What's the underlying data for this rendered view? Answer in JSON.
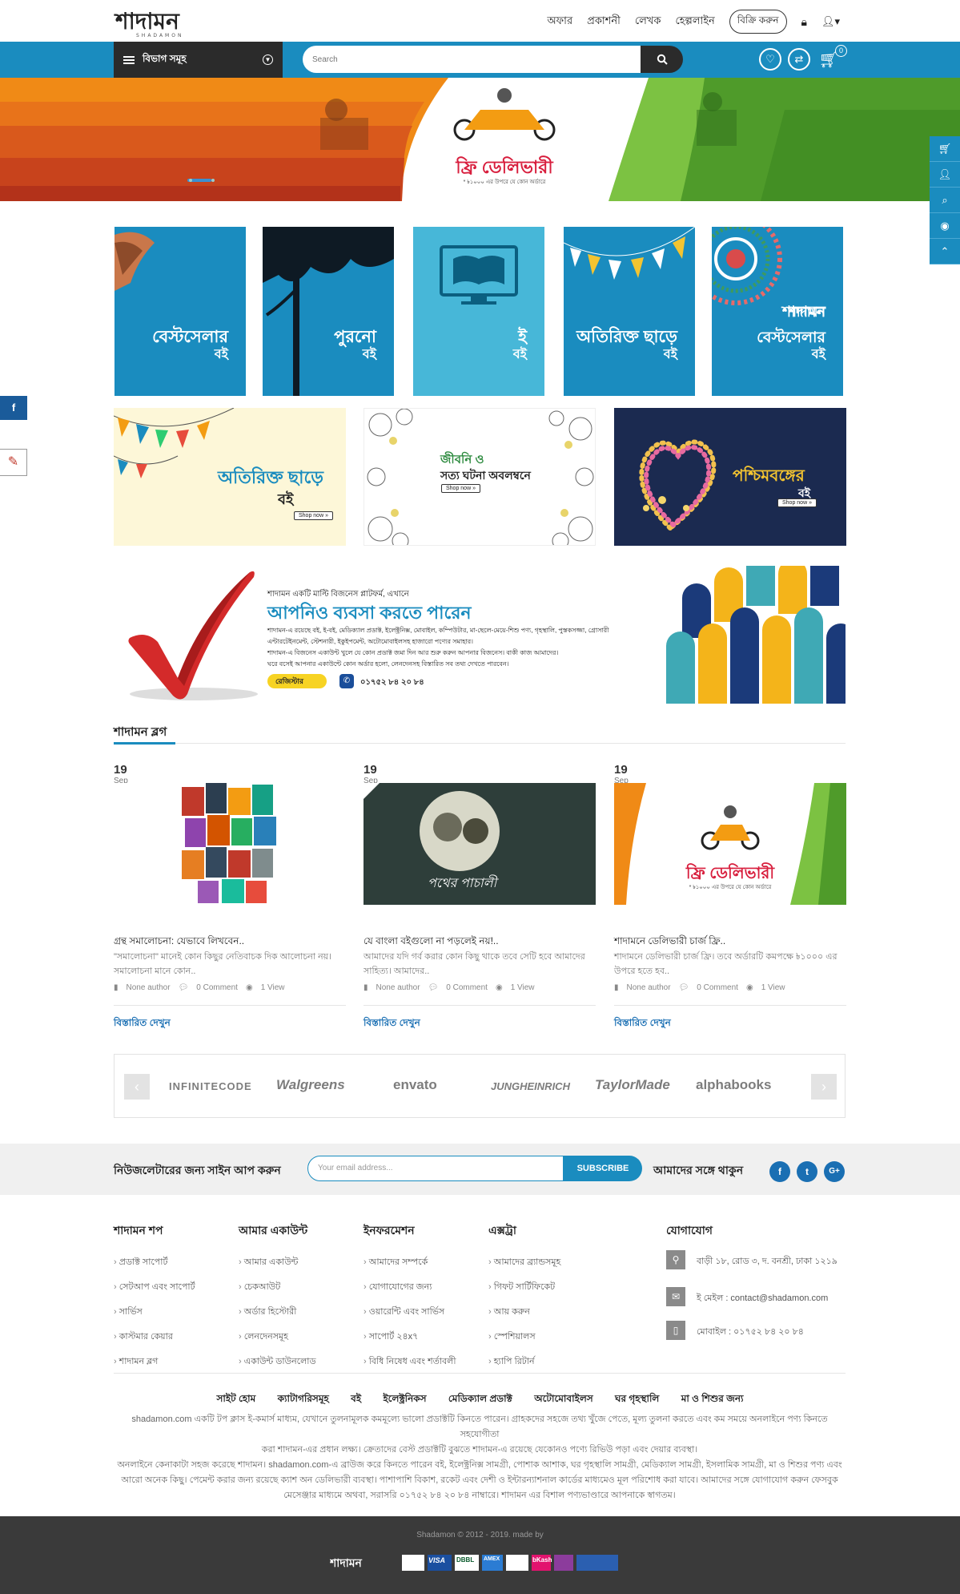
{
  "header": {
    "logo_text": "শাদামন",
    "nav": [
      "অফার",
      "প্রকাশনী",
      "লেখক",
      "হেল্পলাইন"
    ],
    "sell_label": "বিক্রি করুন",
    "departments_label": "বিভাগ সমূহ",
    "search_placeholder": "Search",
    "cart_count": "0"
  },
  "hero": {
    "title": "ফ্রি ডেলিভারী",
    "subtitle": "* ৳১০০০ এর উপরে যে কোন অর্ডারে"
  },
  "tiles": [
    {
      "line1": "বেস্টসেলার",
      "line2": "বই"
    },
    {
      "line1": "পুরনো",
      "line2": "বই"
    },
    {
      "line1": "ই",
      "line2": "বই"
    },
    {
      "line1": "অতিরিক্ত ছাড়ে",
      "line2": "বই"
    },
    {
      "line1": "শাদামন বেস্টসেলার",
      "line2": "বই"
    }
  ],
  "banners": [
    {
      "line1": "অতিরিক্ত ছাড়ে",
      "line2": "বই",
      "cta": "Shop now »"
    },
    {
      "line1": "জীবনি ও",
      "line2": "সত্য ঘটনা অবলম্বনে",
      "cta": "Shop now »"
    },
    {
      "line1": "পশ্চিমবঙ্গের",
      "line2": "বই",
      "cta": "Shop now »"
    }
  ],
  "promo": {
    "intro": "শাদামন একটি মাল্টি বিজনেস প্লাটফর্ম, এখানে",
    "headline": "আপনিও ব্যবসা করতে পারেন",
    "body1": "শাদামন-এ রয়েছে বই, ই-বই, মেডিক্যাল প্রডাক্ট, ইলেক্ট্রনিক্স, মোবাইল, কম্পিউটার, মা-ছেলে-মেয়ে-শিশু পণ্য, গৃহস্থালি, পুস্তকসজ্জা, গ্রোসারী",
    "body2": "এন্টারটেইনমেন্ট, স্টেশনারী, ইকুইপমেন্ট, অটোমোবাইলসহ হাজারো পণ্যের সমাহার।",
    "body3": "শাদামন-এ বিজনেস একাউন্ট খুলে যে কোন প্রডাক্ট জমা দিন আর শুরু করুন আপনার বিজনেস। বাকী কাজ আমাদের।",
    "body4": "ঘরে বসেই আপনার একাউন্টে কোন অর্ডার হলো, লেনদেনসহ বিস্তারিত সব তথ্য দেখতে পারবেন।",
    "register_label": "রেজিস্টার",
    "phone": "০১৭৫২ ৮৪ ২০ ৮৪"
  },
  "blog": {
    "title": "শাদামন ব্লগ",
    "posts": [
      {
        "day": "19",
        "month": "Sep",
        "title": "গ্রন্থ সমালোচনা: যেভাবে লিখবেন..",
        "excerpt": "\"সমালোচনা\" মানেই কোন কিছুর নেতিবাচক দিক আলোচনা নয়। সমালোচনা মানে কোন..",
        "author": "None author",
        "comments": "0 Comment",
        "views": "1 View",
        "more": "বিস্তারিত দেখুন"
      },
      {
        "day": "19",
        "month": "Sep",
        "title": "যে বাংলা বইগুলো না পড়লেই নয়!..",
        "excerpt": "আমাদের যদি গর্ব করার কোন কিছু থাকে তবে সেটি হবে আমাদের সাহিত্য। আমাদের..",
        "author": "None author",
        "comments": "0 Comment",
        "views": "1 View",
        "more": "বিস্তারিত দেখুন",
        "img_caption": "পথের পাচালী"
      },
      {
        "day": "19",
        "month": "Sep",
        "title": "শাদামনে ডেলিভারী চার্জ ফ্রি..",
        "excerpt": "শাদামনে ডেলিভারী চার্জ ফ্রি। তবে অর্ডারটি কমপক্ষে ৳১০০০ এর উপরে হতে হব..",
        "author": "None author",
        "comments": "0 Comment",
        "views": "1 View",
        "more": "বিস্তারিত দেখুন",
        "img_title": "ফ্রি ডেলিভারী",
        "img_sub": "* ৳১০০০ এর উপরে যে কোন অর্ডারে"
      }
    ]
  },
  "brands": [
    "INFINITECODE",
    "Walgreens",
    "envato",
    "JUNGHEINRICH",
    "TaylorMade",
    "alphabooks"
  ],
  "newsletter": {
    "label": "নিউজলেটারের জন্য সাইন আপ করুন",
    "placeholder": "Your email address...",
    "button": "SUBSCRIBE",
    "stay": "আমাদের সঙ্গে থাকুন"
  },
  "footer": {
    "columns": [
      {
        "title": "শাদামন শপ",
        "items": [
          "প্রডাক্ট সাপোর্ট",
          "সেটআপ এবং সাপোর্ট",
          "সার্ভিস",
          "কাস্টমার কেয়ার",
          "শাদামন ব্লগ"
        ]
      },
      {
        "title": "আমার একাউন্ট",
        "items": [
          "আমার একাউন্ট",
          "চেকআউট",
          "অর্ডার হিস্টোরী",
          "লেনদেনসমূহ",
          "একাউন্ট ডাউনলোড"
        ]
      },
      {
        "title": "ইনফরমেশন",
        "items": [
          "আমাদের সম্পর্কে",
          "যোগাযোগের জন্য",
          "ওয়ারেন্টি এবং সার্ভিস",
          "সাপোর্ট ২৪x৭",
          "বিধি নিষেধ এবং শর্তাবলী"
        ]
      },
      {
        "title": "এক্সট্রা",
        "items": [
          "আমাদের ব্র্যান্ডসমূহ",
          "গিফট সার্টিফিকেট",
          "আয় করুন",
          "স্পেশিয়ালস",
          "হ্যাপি রিটার্ন"
        ]
      }
    ],
    "contact_title": "যোগাযোগ",
    "address": "বাড়ী ১৮, রোড ৩, দ. বনশ্রী, ঢাকা ১২১৯",
    "email": "ই মেইল : contact@shadamon.com",
    "phone": "মোবাইল : ০১৭৫২ ৮৪ ২০ ৮৪",
    "links": [
      "সাইট হোম",
      "ক্যাটাগরিসমূহ",
      "বই",
      "ইলেক্ট্রনিকস",
      "মেডিক্যাল প্রডাক্ট",
      "অটোমোবাইলস",
      "ঘর গৃহস্থালি",
      "মা ও শিশুর জন্য"
    ],
    "para1a": "shadamon.com একটি টপ ক্লাস ই-কমার্স মাধ্যম, যেখানে তুলনামূলক কমমূল্যে ভালো প্রডাক্টটি কিনতে পারেন। গ্রাহকদের সহজে তথ্য খুঁজে পেতে, মূল্য তুলনা করতে এবং কম সময়ে অনলাইনে পণ্য কিনতে সহযোগীতা",
    "para1b": "করা শাদামন-এর প্রধান লক্ষ্য। ক্রেতাদের বেস্ট প্রডাক্টটি বুঝতে শাদামন-এ রয়েছে যেকোনও পণ্যে রিভিউ পড়া এবং দেয়ার ব্যবস্থা।",
    "para2a": "অনলাইনে কেনাকাটা সহজ করেছে শাদামন। shadamon.com-এ ব্রাউজ করে কিনতে পারেন বই, ইলেক্ট্রনিক্স সামগ্রী, পোশাক আশাক, ঘর গৃহস্থালি সামগ্রী, মেডিক্যাল সামগ্রী, ইসলামিক সামগ্রী, মা ও শিশুর পণ্য এবং",
    "para2b": "আরো অনেক কিছু। পেমেন্ট করার জন্য রয়েছে ক্যাশ অন ডেলিভারী ব্যবস্থা। পাশাপাশি বিকাশ, রকেট এবং দেশী ও ইন্টারন্যাশনাল কার্ডের মাধ্যমেও মূল পরিশোধ করা যাবে। আমাদের সঙ্গে যোগাযোগ করুন ফেসবুক",
    "para2c": "মেসেঞ্জার মাধ্যমে অথবা, সরাসরি ০১৭৫২ ৮৪ ২০ ৮৪ নাম্বারে। শাদামন এর বিশাল পণ্যভাণ্ডারে আপনাকে স্বাগতম।",
    "copyright": "Shadamon © 2012 - 2019. made by",
    "payments": [
      "VISA",
      "bKash",
      "DBBL",
      "AMEX"
    ]
  }
}
